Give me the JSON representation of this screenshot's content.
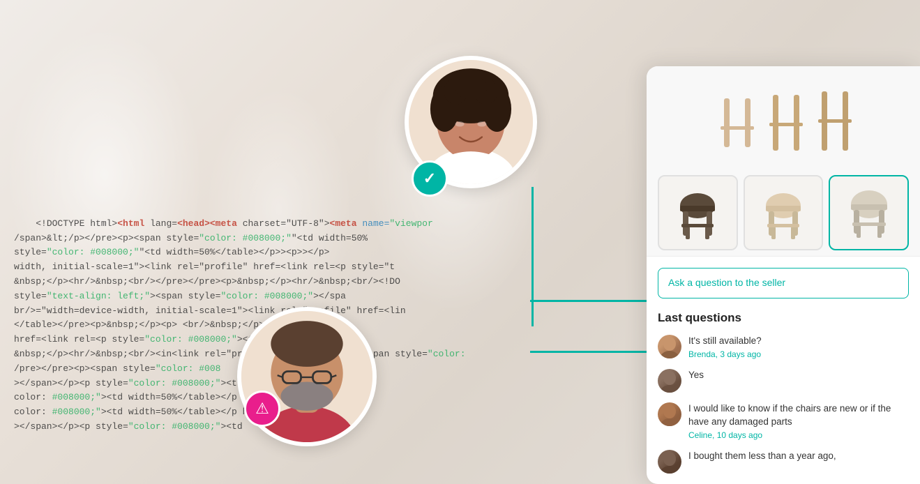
{
  "background": {
    "code_lines": [
      "<!DOCTYPE html><html lang=<head><meta charset=\"UTF-8\"><meta name=\"viewpor",
      "/span>&lt;/p&gt;</pre><p><span style=\"color: #008000;\"&lt;td width=50%",
      "style=\"color: #008000;\"&lt;td width=50%&lt;/table&gt;</p>&lt;p&gt;&nbsp;",
      "width, initial-scale=1><link rel=\"profile\" href=<link rel=&lt;p style=\"",
      "&nbsp;</p><hr/>&nbsp;<br/></pre>&lt;/pre><p>&nbsp;</p><hr/>&nbsp;<br/><!DO",
      "style=\"text-align: left;\"&gt;&lt;span style=\"color: #008000;&gt;&lt;/spa",
      "br/>=\"width=device-width, initial-scale=1\"><link rel=\"profile\" href=<lin",
      "&lt;/table&gt;</pre><p>&nbsp;</p><p> <br/>&nbsp;</p>&nbsp;",
      "href=<link rel=&lt;p style=\"color: #008000;\"&lt;td width=50%&lt;/table&gt",
      "&nbsp;</p><hr/>&nbsp;<br/>&in<link rel=\"profile\" href=<link rel=&lt;span style=\"color:",
      "/pre></pre><p><span style=\"color: #008",
      "&gt;&lt;/span&gt;&lt;/p&gt;&lt;p style=\"color: #008000;\"&lt;td",
      "color: #008000;\"&lt;td width=50%&lt;/table&gt;&lt;/p href=<link rel=&",
      "color: #008000;\"&lt;td width=50%&lt;/table&gt;&lt;/p href=<link rel=&",
      "&gt;&lt;/span&gt;&lt;/p&gt;&lt;p style=\"color: #008000;\"&lt;td"
    ]
  },
  "panel": {
    "ask_placeholder": "Ask a question to the seller",
    "last_questions_title": "Last questions",
    "questions": [
      {
        "id": 1,
        "text": "It's still available?",
        "author": "Brenda",
        "time": "3 days ago",
        "avatar_color": "#c8956c",
        "is_question": true
      },
      {
        "id": 2,
        "text": "Yes",
        "author": "",
        "time": "",
        "avatar_color": "#8a6a5a",
        "is_question": false
      },
      {
        "id": 3,
        "text": "I would like to know if the chairs are new or if the have any damaged parts",
        "author": "Celine",
        "time": "10 days ago",
        "avatar_color": "#b07850",
        "is_question": true
      },
      {
        "id": 4,
        "text": "I bought them less than a year ago,",
        "author": "",
        "time": "",
        "avatar_color": "#7a5540",
        "is_question": false
      }
    ],
    "thumbnails": [
      {
        "id": 1,
        "active": false
      },
      {
        "id": 2,
        "active": false
      },
      {
        "id": 3,
        "active": true
      }
    ]
  },
  "badges": {
    "check": "✓",
    "warning": "⚠"
  }
}
